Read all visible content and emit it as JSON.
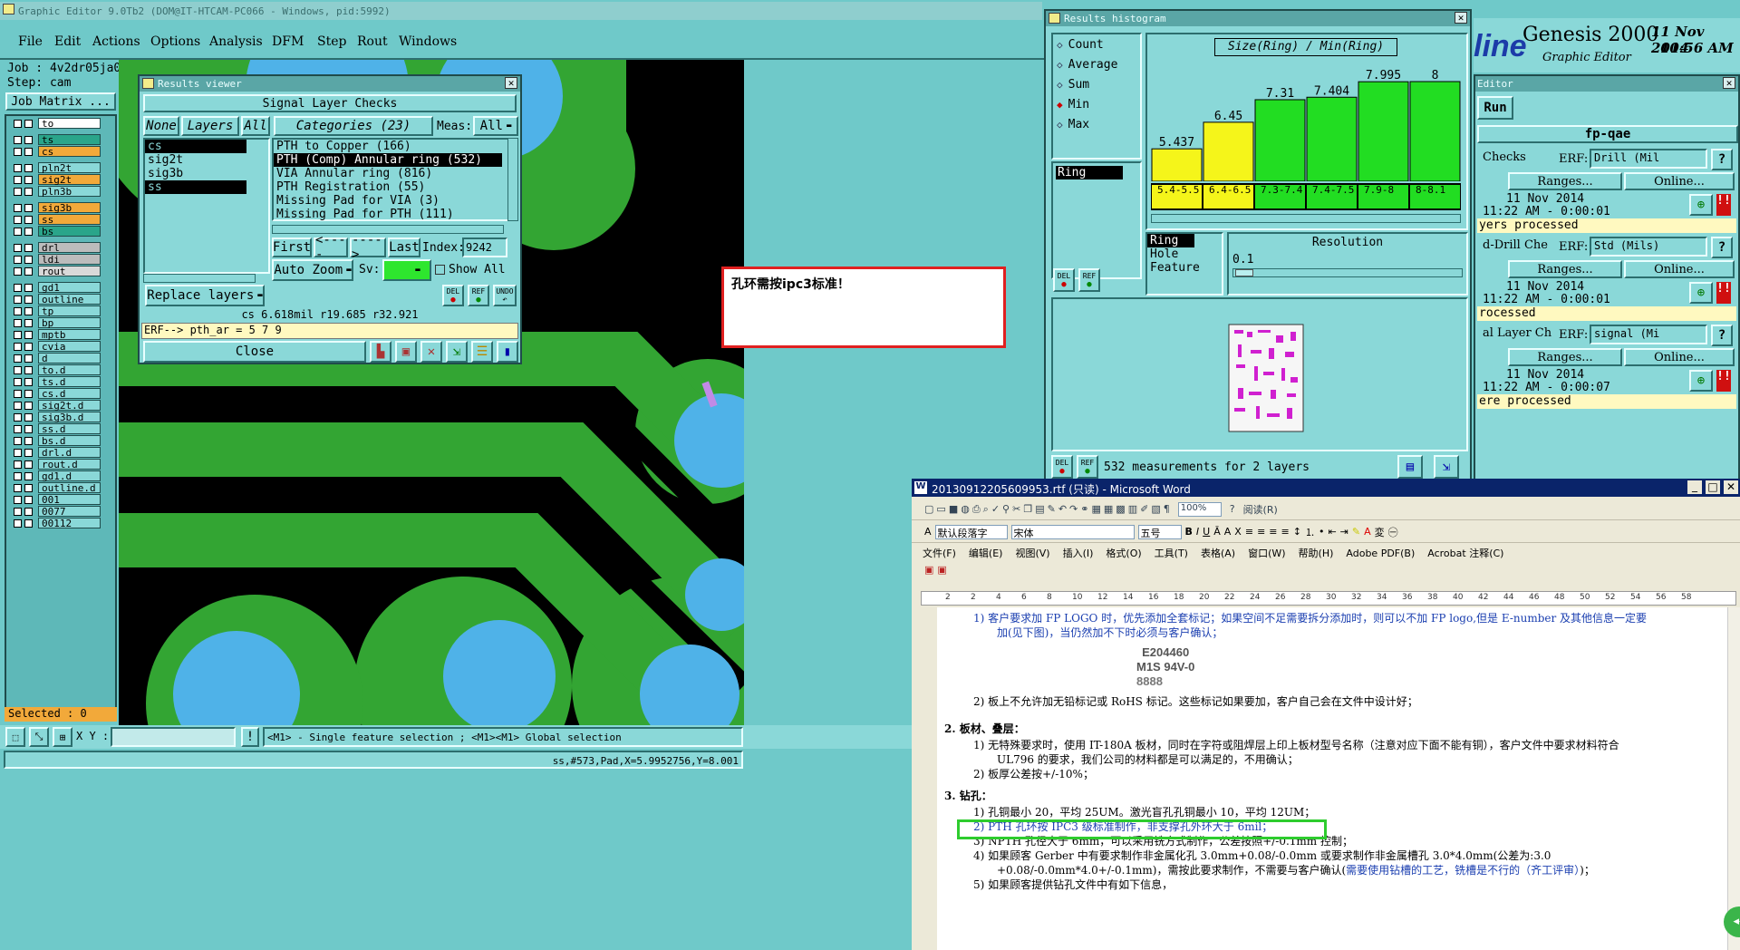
{
  "main_window": {
    "title": "Graphic Editor 9.0Tb2 (DOM@IT-HTCAM-PC066 - Windows, pid:5992)",
    "menu": [
      "File",
      "Edit",
      "Actions",
      "Options",
      "Analysis",
      "DFM",
      "Step",
      "Rout",
      "Windows"
    ],
    "job_label": "Job : 4v2dr05ja0",
    "step_label": "Step: cam",
    "job_matrix_button": "Job Matrix ...",
    "selected_label": "Selected : 0",
    "xy_label": "X Y :",
    "hint_text": "<M1> - Single feature selection ; <M1><M1> Global selection",
    "status_text": "ss,#573,Pad,X=5.9952756,Y=8.001"
  },
  "layers": [
    {
      "name": "to",
      "color": "#ffffff"
    },
    {
      "name": "ts",
      "color": "#2aa58a"
    },
    {
      "name": "cs",
      "color": "#f2a93a"
    },
    {
      "name": "pln2t",
      "color": "#8ad8d8"
    },
    {
      "name": "sig2t",
      "color": "#f2a93a"
    },
    {
      "name": "pln3b",
      "color": "#8ad8d8"
    },
    {
      "name": "sig3b",
      "color": "#f2a93a"
    },
    {
      "name": "ss",
      "color": "#f2a93a"
    },
    {
      "name": "bs",
      "color": "#2aa58a"
    },
    {
      "name": "drl",
      "color": "#bcbcbc"
    },
    {
      "name": "ldi",
      "color": "#bcbcbc"
    },
    {
      "name": "rout",
      "color": "#d9d9d9"
    },
    {
      "name": "gd1",
      "color": "#8ad8d8"
    },
    {
      "name": "outline",
      "color": "#8ad8d8"
    },
    {
      "name": "tp",
      "color": "#8ad8d8"
    },
    {
      "name": "bp",
      "color": "#8ad8d8"
    },
    {
      "name": "mptb",
      "color": "#8ad8d8"
    },
    {
      "name": "cvia",
      "color": "#8ad8d8"
    },
    {
      "name": "d",
      "color": "#8ad8d8"
    },
    {
      "name": "to.d",
      "color": "#8ad8d8"
    },
    {
      "name": "ts.d",
      "color": "#8ad8d8"
    },
    {
      "name": "cs.d",
      "color": "#8ad8d8"
    },
    {
      "name": "sig2t.d",
      "color": "#8ad8d8"
    },
    {
      "name": "sig3b.d",
      "color": "#8ad8d8"
    },
    {
      "name": "ss.d",
      "color": "#8ad8d8"
    },
    {
      "name": "bs.d",
      "color": "#8ad8d8"
    },
    {
      "name": "drl.d",
      "color": "#8ad8d8"
    },
    {
      "name": "rout.d",
      "color": "#8ad8d8"
    },
    {
      "name": "gd1.d",
      "color": "#8ad8d8"
    },
    {
      "name": "outline.d",
      "color": "#8ad8d8"
    },
    {
      "name": "001",
      "color": "#8ad8d8"
    },
    {
      "name": "0077",
      "color": "#8ad8d8"
    },
    {
      "name": "00112",
      "color": "#8ad8d8"
    }
  ],
  "results_viewer": {
    "title": "Results viewer",
    "header": "Signal Layer Checks",
    "none_btn": "None",
    "layers_btn": "Layers",
    "all_btn": "All",
    "layer_list": [
      "cs",
      "sig2t",
      "sig3b",
      "ss"
    ],
    "categories_btn": "Categories (23)",
    "meas_label": "Meas:",
    "meas_value": "All",
    "categories": [
      "PTH to Copper (166)",
      "PTH (Comp) Annular ring (532)",
      "VIA Annular ring (816)",
      "PTH Registration (55)",
      "Missing Pad for VIA (3)",
      "Missing Pad for PTH (111)"
    ],
    "first_btn": "First",
    "prev_btn": "<----",
    "next_btn": "---->",
    "last_btn": "Last",
    "index_label": "Index:",
    "index_value": "9242",
    "auto_zoom": "Auto Zoom",
    "sv_label": "Sv:",
    "show_all": "Show All",
    "replace_layers": "Replace layers",
    "del": "DEL",
    "ref": "REF",
    "undo": "UNDO",
    "measure_line": "cs 6.618mil  r19.685  r32.921",
    "erf_line": "ERF--> pth_ar = 5 7 9",
    "close_btn": "Close"
  },
  "annotation_note": "孔环需按ipc3标准！",
  "histogram": {
    "title": "Results histogram",
    "options": [
      "Count",
      "Average",
      "Sum",
      "Min",
      "Max"
    ],
    "selected_option": "Min",
    "field_value": "Ring",
    "chart_title": "Size(Ring) / Min(Ring)",
    "list_items": [
      "Ring",
      "Hole",
      "Feature"
    ],
    "resolution_label": "Resolution",
    "resolution_value": "0.1",
    "del": "DEL",
    "ref": "REF",
    "footer": "532 measurements for 2 layers"
  },
  "chart_data": {
    "type": "bar",
    "title": "Size(Ring) / Min(Ring)",
    "categories": [
      "5.4-5.5",
      "6.4-6.5",
      "7.3-7.4",
      "7.4-7.5",
      "7.9-8",
      "8-8.1"
    ],
    "values": [
      5.437,
      6.45,
      7.31,
      7.404,
      7.995,
      8
    ],
    "value_labels": [
      "5.437",
      "6.45",
      "7.31",
      "7.404",
      "7.995",
      "8"
    ],
    "bar_colors": [
      "#f5f51a",
      "#f5f51a",
      "#22dd22",
      "#22dd22",
      "#22dd22",
      "#22dd22"
    ]
  },
  "genesis": {
    "brand_fragment": "line",
    "title": "Genesis 2000",
    "subtitle": "Graphic Editor",
    "date": "11 Nov 2014",
    "time": "10:56 AM"
  },
  "checklist_panel": {
    "title": "Editor",
    "run_btn": "Run",
    "header": "fp-qae",
    "erf_label": "ERF:",
    "ranges_btn": "Ranges...",
    "online_btn": "Online...",
    "help": "?",
    "sections": [
      {
        "name": "Checks",
        "erf": "Drill (Mil",
        "date": "11 Nov 2014",
        "time": "11:22 AM - 0:00:01",
        "status": "yers processed"
      },
      {
        "name": "d-Drill Che",
        "erf": "Std (Mils)",
        "date": "11 Nov 2014",
        "time": "11:22 AM - 0:00:01",
        "status": "rocessed"
      },
      {
        "name": "al Layer Ch",
        "erf": "signal (Mi",
        "date": "11 Nov 2014",
        "time": "11:22 AM - 0:00:07",
        "status": "ere processed"
      }
    ]
  },
  "word": {
    "title": "20130912205609953.rtf (只读) - Microsoft Word",
    "style_value": "默认段落字",
    "font_value": "宋体",
    "size_value": "五号",
    "zoom_value": "100%",
    "read_btn": "阅读(R)",
    "menu": [
      "文件(F)",
      "编辑(E)",
      "视图(V)",
      "插入(I)",
      "格式(O)",
      "工具(T)",
      "表格(A)",
      "窗口(W)",
      "帮助(H)",
      "Adobe PDF(B)",
      "Acrobat 注释(C)"
    ],
    "ruler_numbers": [
      "2",
      "2",
      "4",
      "6",
      "8",
      "10",
      "12",
      "14",
      "16",
      "18",
      "20",
      "22",
      "24",
      "26",
      "28",
      "30",
      "32",
      "34",
      "36",
      "38",
      "40",
      "42",
      "44",
      "46",
      "48",
      "50",
      "52",
      "54",
      "56",
      "58"
    ],
    "para1_item1": "1)  客户要求加 FP LOGO 时，优先添加全套标记；如果空间不足需要拆分添加时，则可以不加 FP logo,但是 E-number 及其他信息一定要",
    "para1_item1b": "加(见下图)，当仍然加不下时必须与客户确认；",
    "logo_line1": "E204460",
    "logo_line2": "M1S 94V-0",
    "logo_line3": "8888",
    "para1_item2": "2)  板上不允许加无铅标记或 RoHS 标记。这些标记如果要加，客户自己会在文件中设计好；",
    "heading2": "2.  板材、叠层：",
    "para2_item1": "1)  无特殊要求时，使用 IT-180A 板材，同时在字符或阻焊层上印上板材型号名称（注意对应下面不能有铜），客户文件中要求材料符合",
    "para2_item1b": "UL796 的要求，我们公司的材料都是可以满足的，不用确认；",
    "para2_item2": "2)  板厚公差按+/-10%；",
    "heading3": "3.  钻孔：",
    "para3_item1": "1)  孔铜最小 20，平均 25UM。激光盲孔孔铜最小 10，平均 12UM；",
    "para3_item2": "2)  PTH 孔环按 IPC3 级标准制作，非支撑孔外环大于 6mil；",
    "para3_item3": "3)  NPTH 孔径大于 6mm，可以采用铣方式制作，公差按照+/-0.1mm 控制；",
    "para3_item4": "4)  如果顾客 Gerber 中有要求制作非金属化孔 3.0mm+0.08/-0.0mm 或要求制作非金属槽孔 3.0*4.0mm(公差为:3.0",
    "para3_item4b": "+0.08/-0.0mm*4.0+/-0.1mm)，需按此要求制作，不需要与客户确认(",
    "para3_item4c": "需要使用钻槽的工艺，铣槽是不行的（齐工评审）",
    "para3_item4d": ")；",
    "para3_item5": "5)  如果顾客提供钻孔文件中有如下信息，"
  }
}
